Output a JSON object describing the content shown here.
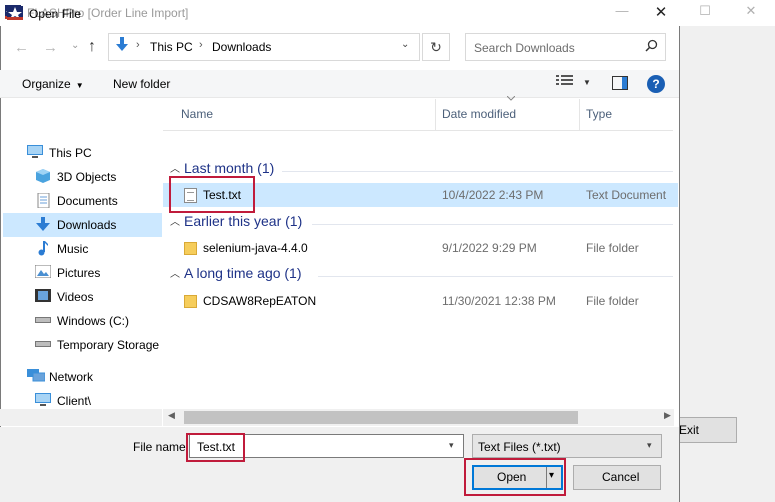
{
  "parent_window": {
    "title": "FLASHPro [Order Line Import]",
    "minimize": "—",
    "maximize": "☐",
    "close": "✕",
    "exit_button_label": "Exit"
  },
  "dialog": {
    "title": "Open File",
    "close": "✕"
  },
  "navigation": {
    "back": "←",
    "forward": "→",
    "recent": "⌄",
    "up": "↑"
  },
  "address_bar": {
    "crumbs": [
      "This PC",
      "Downloads"
    ],
    "separator": "›",
    "dropdown": "⌄",
    "refresh": "↻"
  },
  "search": {
    "placeholder": "Search Downloads"
  },
  "toolbar": {
    "organize_label": "Organize",
    "organize_arrow": "▼",
    "new_folder_label": "New folder",
    "view_arrow": "▼",
    "help": "?"
  },
  "nav_pane": {
    "items": [
      {
        "label": "This PC",
        "icon": "computer-icon"
      },
      {
        "label": "3D Objects",
        "icon": "cube-icon"
      },
      {
        "label": "Documents",
        "icon": "documents-icon"
      },
      {
        "label": "Downloads",
        "icon": "download-icon"
      },
      {
        "label": "Music",
        "icon": "music-icon"
      },
      {
        "label": "Pictures",
        "icon": "pictures-icon"
      },
      {
        "label": "Videos",
        "icon": "videos-icon"
      },
      {
        "label": "Windows (C:)",
        "icon": "drive-icon"
      },
      {
        "label": "Temporary Storage",
        "icon": "drive-icon"
      },
      {
        "label": "Network",
        "icon": "network-icon"
      },
      {
        "label": "Client\\",
        "icon": "monitor-icon"
      }
    ]
  },
  "columns": {
    "name": "Name",
    "date_modified": "Date modified",
    "type": "Type"
  },
  "groups": [
    {
      "header": "Last month (1)",
      "files": [
        {
          "name": "Test.txt",
          "date": "10/4/2022 2:43 PM",
          "type": "Text Document",
          "icon": "text-file-icon"
        }
      ]
    },
    {
      "header": "Earlier this year (1)",
      "files": [
        {
          "name": "selenium-java-4.4.0",
          "date": "9/1/2022 9:29 PM",
          "type": "File folder",
          "icon": "folder-icon"
        }
      ]
    },
    {
      "header": "A long time ago (1)",
      "files": [
        {
          "name": "CDSAW8RepEATON",
          "date": "11/30/2021 12:38 PM",
          "type": "File folder",
          "icon": "folder-icon"
        }
      ]
    }
  ],
  "bottom": {
    "filename_label": "File name:",
    "filename_value": "Test.txt",
    "filetype_value": "Text Files (*.txt)",
    "dropdown": "▾",
    "open_label": "Open",
    "open_arrow": "▾",
    "cancel_label": "Cancel"
  },
  "scrollbar": {
    "left": "◀",
    "right": "▶"
  },
  "colors": {
    "selection": "#cce8ff",
    "group_header": "#1e3287",
    "highlight_box": "#c01b3b",
    "accent": "#0078d7"
  }
}
